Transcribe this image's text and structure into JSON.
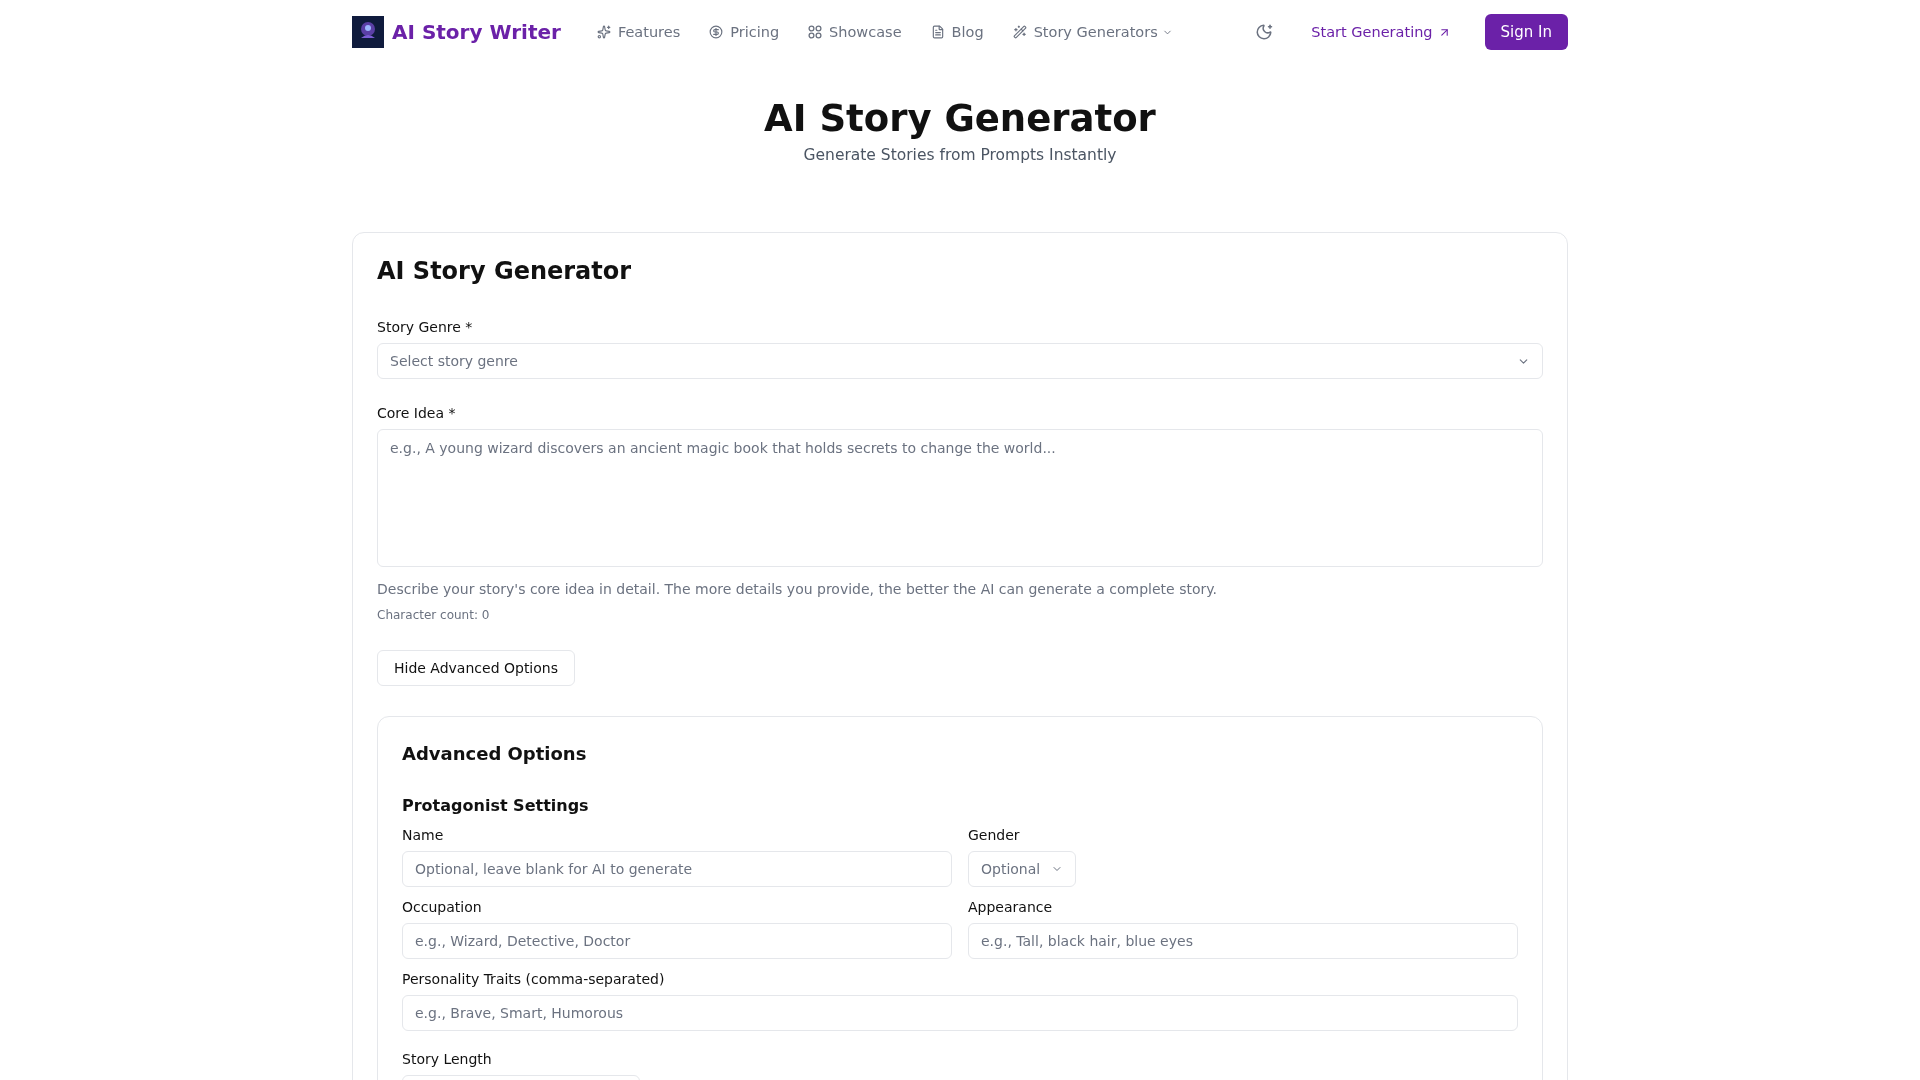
{
  "header": {
    "brand": "AI Story Writer",
    "nav": [
      {
        "label": "Features",
        "dropdown": false
      },
      {
        "label": "Pricing",
        "dropdown": false
      },
      {
        "label": "Showcase",
        "dropdown": false
      },
      {
        "label": "Blog",
        "dropdown": false
      },
      {
        "label": "Story Generators",
        "dropdown": true
      }
    ],
    "cta": "Start Generating",
    "sign_in": "Sign In"
  },
  "hero": {
    "title": "AI Story Generator",
    "subtitle": "Generate Stories from Prompts Instantly"
  },
  "form": {
    "title": "AI Story Generator",
    "genre": {
      "label": "Story Genre *",
      "placeholder": "Select story genre"
    },
    "core_idea": {
      "label": "Core Idea *",
      "placeholder": "e.g., A young wizard discovers an ancient magic book that holds secrets to change the world...",
      "help": "Describe your story's core idea in detail. The more details you provide, the better the AI can generate a complete story.",
      "count": "Character count: 0"
    },
    "toggle_button": "Hide Advanced Options",
    "advanced": {
      "title": "Advanced Options",
      "section": "Protagonist Settings",
      "fields": [
        {
          "kind": "input",
          "label": "Name",
          "placeholder": "Optional, leave blank for AI to generate"
        },
        {
          "kind": "select",
          "label": "Gender",
          "placeholder": "Optional"
        },
        {
          "kind": "input",
          "label": "Occupation",
          "placeholder": "e.g., Wizard, Detective, Doctor"
        },
        {
          "kind": "input",
          "label": "Appearance",
          "placeholder": "e.g., Tall, black hair, blue eyes"
        },
        {
          "kind": "wide",
          "label": "Personality Traits (comma-separated)",
          "placeholder": "e.g., Brave, Smart, Humorous"
        }
      ],
      "length_label": "Story Length"
    }
  }
}
